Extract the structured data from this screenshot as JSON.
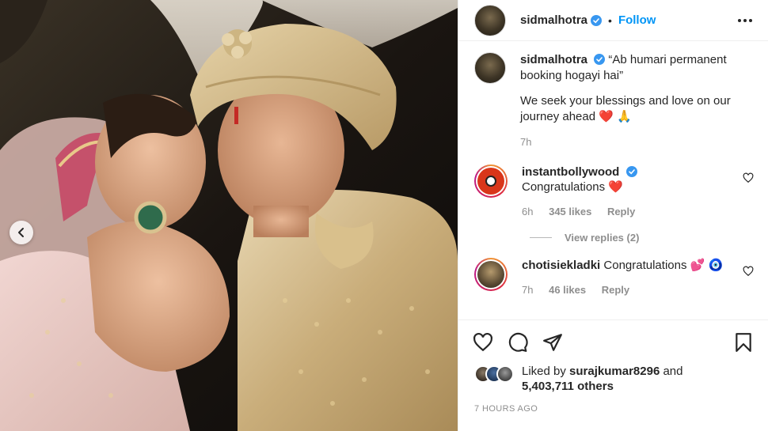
{
  "header": {
    "username": "sidmalhotra",
    "separator": "•",
    "follow_label": "Follow"
  },
  "caption": {
    "username": "sidmalhotra",
    "line1": "“Ab humari permanent booking hogayi hai”",
    "line2": "We seek your blessings and love on our journey ahead",
    "emojis": "❤️ 🙏",
    "time": "7h"
  },
  "comments": [
    {
      "username": "instantbollywood",
      "verified": true,
      "text": "Congratulations",
      "emoji": "❤️",
      "time": "6h",
      "likes": "345 likes",
      "reply": "Reply",
      "view_replies": "View replies (2)"
    },
    {
      "username": "chotisiekladki",
      "verified": false,
      "text": "Congratulations",
      "emoji": "💕 🧿",
      "time": "7h",
      "likes": "46 likes",
      "reply": "Reply"
    }
  ],
  "likes": {
    "prefix": "Liked by",
    "user": "surajkumar8296",
    "and": "and",
    "count": "5,403,711 others"
  },
  "timestamp": "7 HOURS AGO",
  "colors": {
    "accent": "#0095f6",
    "verified": "#3897f0",
    "heart": "#ed4956",
    "muted": "#8e8e8e"
  },
  "icons": [
    "chevron-left-icon",
    "verified-badge-icon",
    "more-options-icon",
    "heart-icon",
    "comment-icon",
    "share-icon",
    "bookmark-icon"
  ]
}
